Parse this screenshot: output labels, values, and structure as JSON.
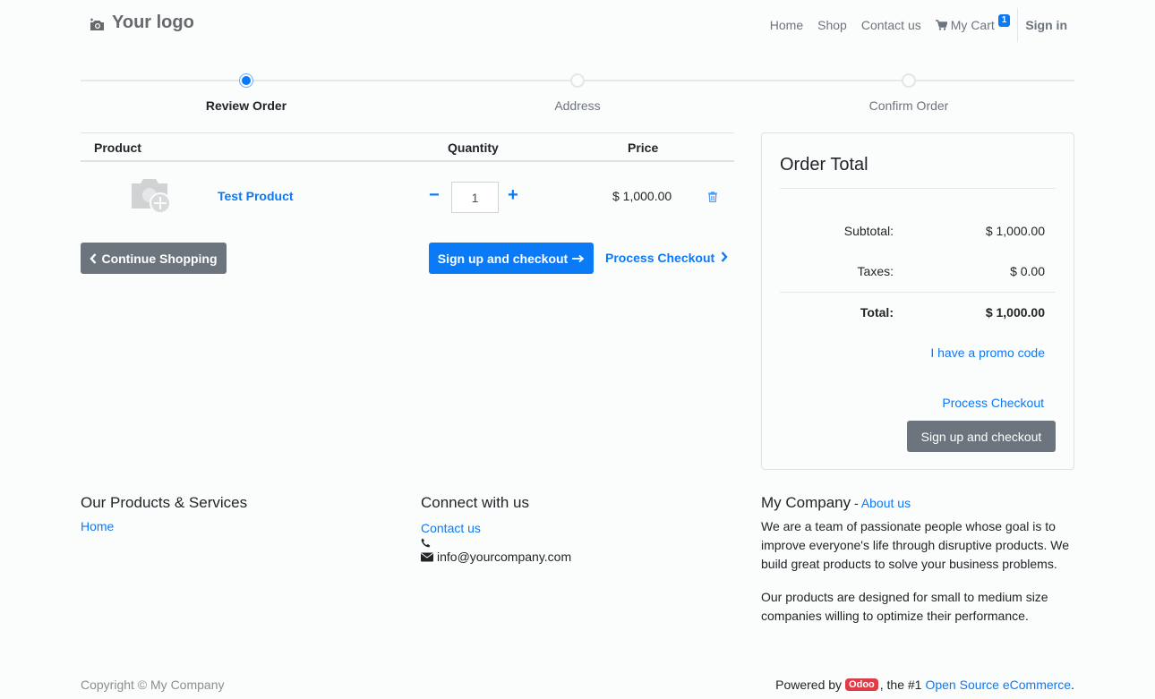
{
  "header": {
    "logo_text": "Your logo",
    "nav": [
      {
        "label": "Home"
      },
      {
        "label": "Shop"
      },
      {
        "label": "Contact us"
      }
    ],
    "cart_label": "My Cart",
    "cart_count": "1",
    "signin_label": "Sign in"
  },
  "progress": {
    "steps": [
      {
        "label": "Review Order",
        "active": true
      },
      {
        "label": "Address",
        "active": false
      },
      {
        "label": "Confirm Order",
        "active": false
      }
    ]
  },
  "cart": {
    "columns": [
      "Product",
      "Quantity",
      "Price"
    ],
    "items": [
      {
        "name": "Test Product",
        "quantity": "1",
        "price": "$ 1,000.00"
      }
    ],
    "continue_label": "Continue Shopping",
    "signup_label": "Sign up and checkout",
    "process_label": "Process Checkout"
  },
  "order_total": {
    "title": "Order Total",
    "subtotal_label": "Subtotal:",
    "subtotal": "$ 1,000.00",
    "taxes_label": "Taxes:",
    "taxes": "$ 0.00",
    "total_label": "Total:",
    "total": "$ 1,000.00",
    "promo_label": "I have a promo code",
    "process_label": "Process Checkout",
    "signup_label": "Sign up and checkout"
  },
  "footer": {
    "col1_title": "Our Products & Services",
    "col1_link": "Home",
    "col2_title": "Connect with us",
    "col2_link": "Contact us",
    "phone": "",
    "email": "info@yourcompany.com",
    "col3_title": "My Company",
    "col3_sep": " - ",
    "col3_link": "About us",
    "about_p1": "We are a team of passionate people whose goal is to improve everyone's life through disruptive products. We build great products to solve your business problems.",
    "about_p2": "Our products are designed for small to medium size companies willing to optimize their performance.",
    "copyright": "Copyright © My Company",
    "powered_by": "Powered by",
    "odoo_badge": "Odoo",
    "powered_mid": ", the #1",
    "powered_link": "Open Source eCommerce",
    "powered_end": "."
  },
  "colors": {
    "primary": "#0b7af7",
    "secondary": "#6c757d",
    "odoo": "#e03c48"
  }
}
